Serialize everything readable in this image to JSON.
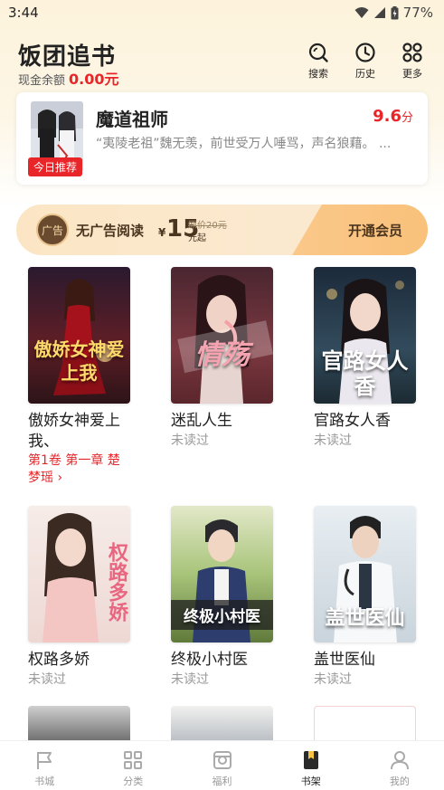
{
  "status_bar": {
    "time": "3:44",
    "battery": "77%"
  },
  "header": {
    "app_title": "饭团追书",
    "balance_label": "现金余额",
    "balance_value": "0.00元",
    "actions": [
      {
        "label": "搜索",
        "icon": "search-icon"
      },
      {
        "label": "历史",
        "icon": "clock-icon"
      },
      {
        "label": "更多",
        "icon": "grid-icon"
      }
    ]
  },
  "recommend": {
    "title": "魔道祖师",
    "score": "9.6",
    "score_unit": "分",
    "description": "“夷陵老祖”魏无羡，前世受万人唾骂，声名狼藉。 ...",
    "badge": "今日推荐"
  },
  "vip_banner": {
    "logo": "广告",
    "text": "无广告阅读",
    "price_symbol": "¥",
    "price": "15",
    "original_price": "原价20元",
    "price_suffix": "元起",
    "open_label": "开通会员"
  },
  "books": [
    {
      "title": "傲娇女神爱上我、",
      "status": "",
      "progress": "第1卷 第一章 楚梦瑶 ›",
      "cover_text": "傲娇女神爱上我"
    },
    {
      "title": "迷乱人生",
      "status": "未读过",
      "progress": "",
      "cover_text": "情殇"
    },
    {
      "title": "官路女人香",
      "status": "未读过",
      "progress": "",
      "cover_text": "官路女人香"
    },
    {
      "title": "权路多娇",
      "status": "未读过",
      "progress": "",
      "cover_text": "权路多娇"
    },
    {
      "title": "终极小村医",
      "status": "未读过",
      "progress": "",
      "cover_text": "终极小村医"
    },
    {
      "title": "盖世医仙",
      "status": "未读过",
      "progress": "",
      "cover_text": "盖世医仙"
    }
  ],
  "bottom_nav": [
    {
      "label": "书城",
      "icon": "flag-icon"
    },
    {
      "label": "分类",
      "icon": "category-icon"
    },
    {
      "label": "福利",
      "icon": "gift-icon"
    },
    {
      "label": "书架",
      "icon": "bookshelf-icon",
      "active": true
    },
    {
      "label": "我的",
      "icon": "profile-icon"
    }
  ],
  "colors": {
    "accent": "#e8262a",
    "vip_brown": "#4a3520",
    "header_bg": "#fdf3dc"
  }
}
